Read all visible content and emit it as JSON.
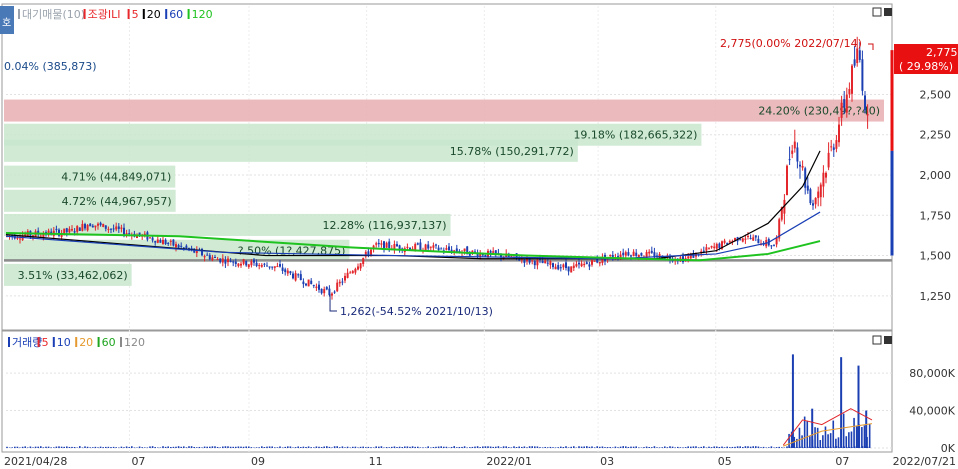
{
  "top_legend": {
    "side_tab": "호",
    "items": [
      {
        "text": "대기매물(10)",
        "color": "#9aa3ad"
      },
      {
        "text": "조광ILI",
        "color": "#e8282b"
      },
      {
        "text": "5",
        "color": "#e8282b"
      },
      {
        "text": "20",
        "color": "#000000"
      },
      {
        "text": "60",
        "color": "#1a3fb5"
      },
      {
        "text": "120",
        "color": "#1fc31f"
      }
    ]
  },
  "bottom_legend": {
    "items": [
      {
        "text": "거래량",
        "color": "#1a3fb5"
      },
      {
        "text": "5",
        "color": "#e8282b"
      },
      {
        "text": "10",
        "color": "#1a3fb5"
      },
      {
        "text": "20",
        "color": "#e59a2f"
      },
      {
        "text": "60",
        "color": "#1fa51f"
      },
      {
        "text": "120",
        "color": "#8a8a8a"
      }
    ]
  },
  "price_labels": {
    "current_value": "2,775",
    "current_pct": "( 29.98%)",
    "high_annotation": "2,775(0.00% 2022/07/14)",
    "low_annotation": "1,262(-54.52% 2021/10/13)",
    "top_left_note": "0.04% (385,873)"
  },
  "x_axis": {
    "labels": [
      "2021/04/28",
      "07",
      "09",
      "11",
      "2022/01",
      "03",
      "05",
      "07",
      "2022/07/21"
    ]
  },
  "chart_data": [
    {
      "type": "candlestick",
      "title": "",
      "series_name": "조광ILI",
      "y_ticks": [
        "2,500",
        "2,250",
        "2,000",
        "1,750",
        "1,500",
        "1,250"
      ],
      "ylim": [
        1100,
        2900
      ],
      "xlim": [
        "2021/04/28",
        "2022/07/21"
      ],
      "volume_profile": [
        {
          "label": "24.20% (230,49?,?40)",
          "price": 2400,
          "highlight": true
        },
        {
          "label": "19.18% (182,665,322)",
          "price": 2250
        },
        {
          "label": "15.78% (150,291,772)",
          "price": 2150
        },
        {
          "label": "4.71% (44,849,071)",
          "price": 1990
        },
        {
          "label": "4.72% (44,967,957)",
          "price": 1840
        },
        {
          "label": "12.28% (116,937,137)",
          "price": 1690
        },
        {
          "label": "?.50% (1?,427,875)",
          "price": 1530
        },
        {
          "label": "3.51% (33,462,062)",
          "price": 1380
        }
      ],
      "current_price": 2775,
      "reference_line": 1470,
      "key_points": [
        {
          "date": "2021/04/28",
          "price": 1620
        },
        {
          "date": "2021/06/01",
          "price": 1650
        },
        {
          "date": "2021/06/10",
          "price": 1700
        },
        {
          "date": "2021/07/15",
          "price": 1600
        },
        {
          "date": "2021/08/15",
          "price": 1480
        },
        {
          "date": "2021/09/15",
          "price": 1430
        },
        {
          "date": "2021/10/13",
          "price": 1262
        },
        {
          "date": "2021/11/05",
          "price": 1560
        },
        {
          "date": "2021/12/01",
          "price": 1550
        },
        {
          "date": "2022/01/10",
          "price": 1500
        },
        {
          "date": "2022/02/15",
          "price": 1420
        },
        {
          "date": "2022/03/15",
          "price": 1520
        },
        {
          "date": "2022/04/15",
          "price": 1480
        },
        {
          "date": "2022/05/15",
          "price": 1620
        },
        {
          "date": "2022/06/01",
          "price": 1560
        },
        {
          "date": "2022/06/10",
          "price": 2250
        },
        {
          "date": "2022/06/20",
          "price": 1800
        },
        {
          "date": "2022/07/01",
          "price": 2200
        },
        {
          "date": "2022/07/14",
          "price": 2775
        },
        {
          "date": "2022/07/21",
          "price": 2100
        }
      ],
      "moving_averages": [
        {
          "name": "20",
          "color": "#000000",
          "points": [
            [
              0.0,
              1630
            ],
            [
              0.3,
              1500
            ],
            [
              0.45,
              1500
            ],
            [
              0.55,
              1480
            ],
            [
              0.75,
              1480
            ],
            [
              0.82,
              1530
            ],
            [
              0.88,
              1700
            ],
            [
              0.92,
              1930
            ],
            [
              0.94,
              2150
            ]
          ]
        },
        {
          "name": "60",
          "color": "#1a3fb5",
          "points": [
            [
              0.0,
              1620
            ],
            [
              0.25,
              1520
            ],
            [
              0.45,
              1500
            ],
            [
              0.7,
              1480
            ],
            [
              0.82,
              1510
            ],
            [
              0.88,
              1580
            ],
            [
              0.94,
              1770
            ]
          ]
        },
        {
          "name": "120",
          "color": "#1fc31f",
          "points": [
            [
              0.0,
              1640
            ],
            [
              0.2,
              1620
            ],
            [
              0.4,
              1550
            ],
            [
              0.6,
              1500
            ],
            [
              0.8,
              1470
            ],
            [
              0.88,
              1510
            ],
            [
              0.94,
              1590
            ]
          ]
        }
      ]
    },
    {
      "type": "bar",
      "title": "",
      "series_name": "거래량",
      "y_ticks": [
        "80,000K",
        "40,000K",
        "0K"
      ],
      "ylim": [
        0,
        110000
      ],
      "spikes": [
        {
          "date": "2022/06/10",
          "value": 100000
        },
        {
          "date": "2022/06/20",
          "value": 42000
        },
        {
          "date": "2022/07/05",
          "value": 97000
        },
        {
          "date": "2022/07/14",
          "value": 88000
        },
        {
          "date": "2022/07/18",
          "value": 40000
        }
      ]
    }
  ]
}
